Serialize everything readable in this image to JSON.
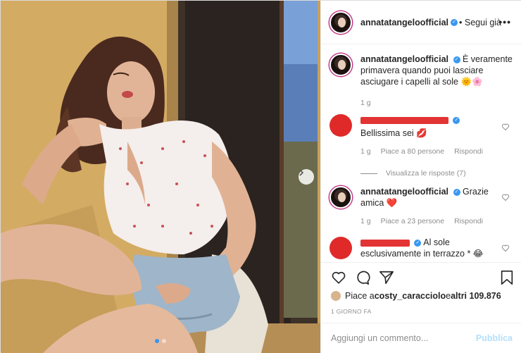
{
  "post": {
    "author": "annatatangeloofficial",
    "follow_label": "• Segui già",
    "more_label": "•••",
    "caption_text": "È veramente primavera quando puoi lasciare asciugare i capelli al sole 🌞🌸",
    "caption_age": "1 g",
    "image_alt": "Donna seduta al sole con camicetta bianca a fiori e shorts di jeans"
  },
  "comments": [
    {
      "author": "",
      "text": "Bellissima sei 💋",
      "age": "1 g",
      "likes": "Piace a 80 persone",
      "reply": "Rispondi"
    },
    {
      "author": "annatatangeloofficial",
      "text": "Grazie amica ❤️",
      "age": "1 g",
      "likes": "Piace a 23 persone",
      "reply": "Rispondi"
    },
    {
      "author": "",
      "text": "Al sole esclusivamente in terrazzo * 😂",
      "age": "",
      "likes": "",
      "reply": ""
    }
  ],
  "view_replies": "Visualizza le risposte (7)",
  "likes": {
    "prefix": "Piace a ",
    "user": "costy_caracciolo",
    "middle": " e ",
    "others": "altri 109.876"
  },
  "timestamp": "1 GIORNO FA",
  "add_comment": {
    "placeholder": "Aggiungi un commento...",
    "publish_label": "Pubblica"
  },
  "carousel": {
    "current": 1,
    "total": 2
  },
  "colors": {
    "accent": "#3897f0",
    "redaction": "#e23434",
    "publish": "#b2dffc"
  }
}
